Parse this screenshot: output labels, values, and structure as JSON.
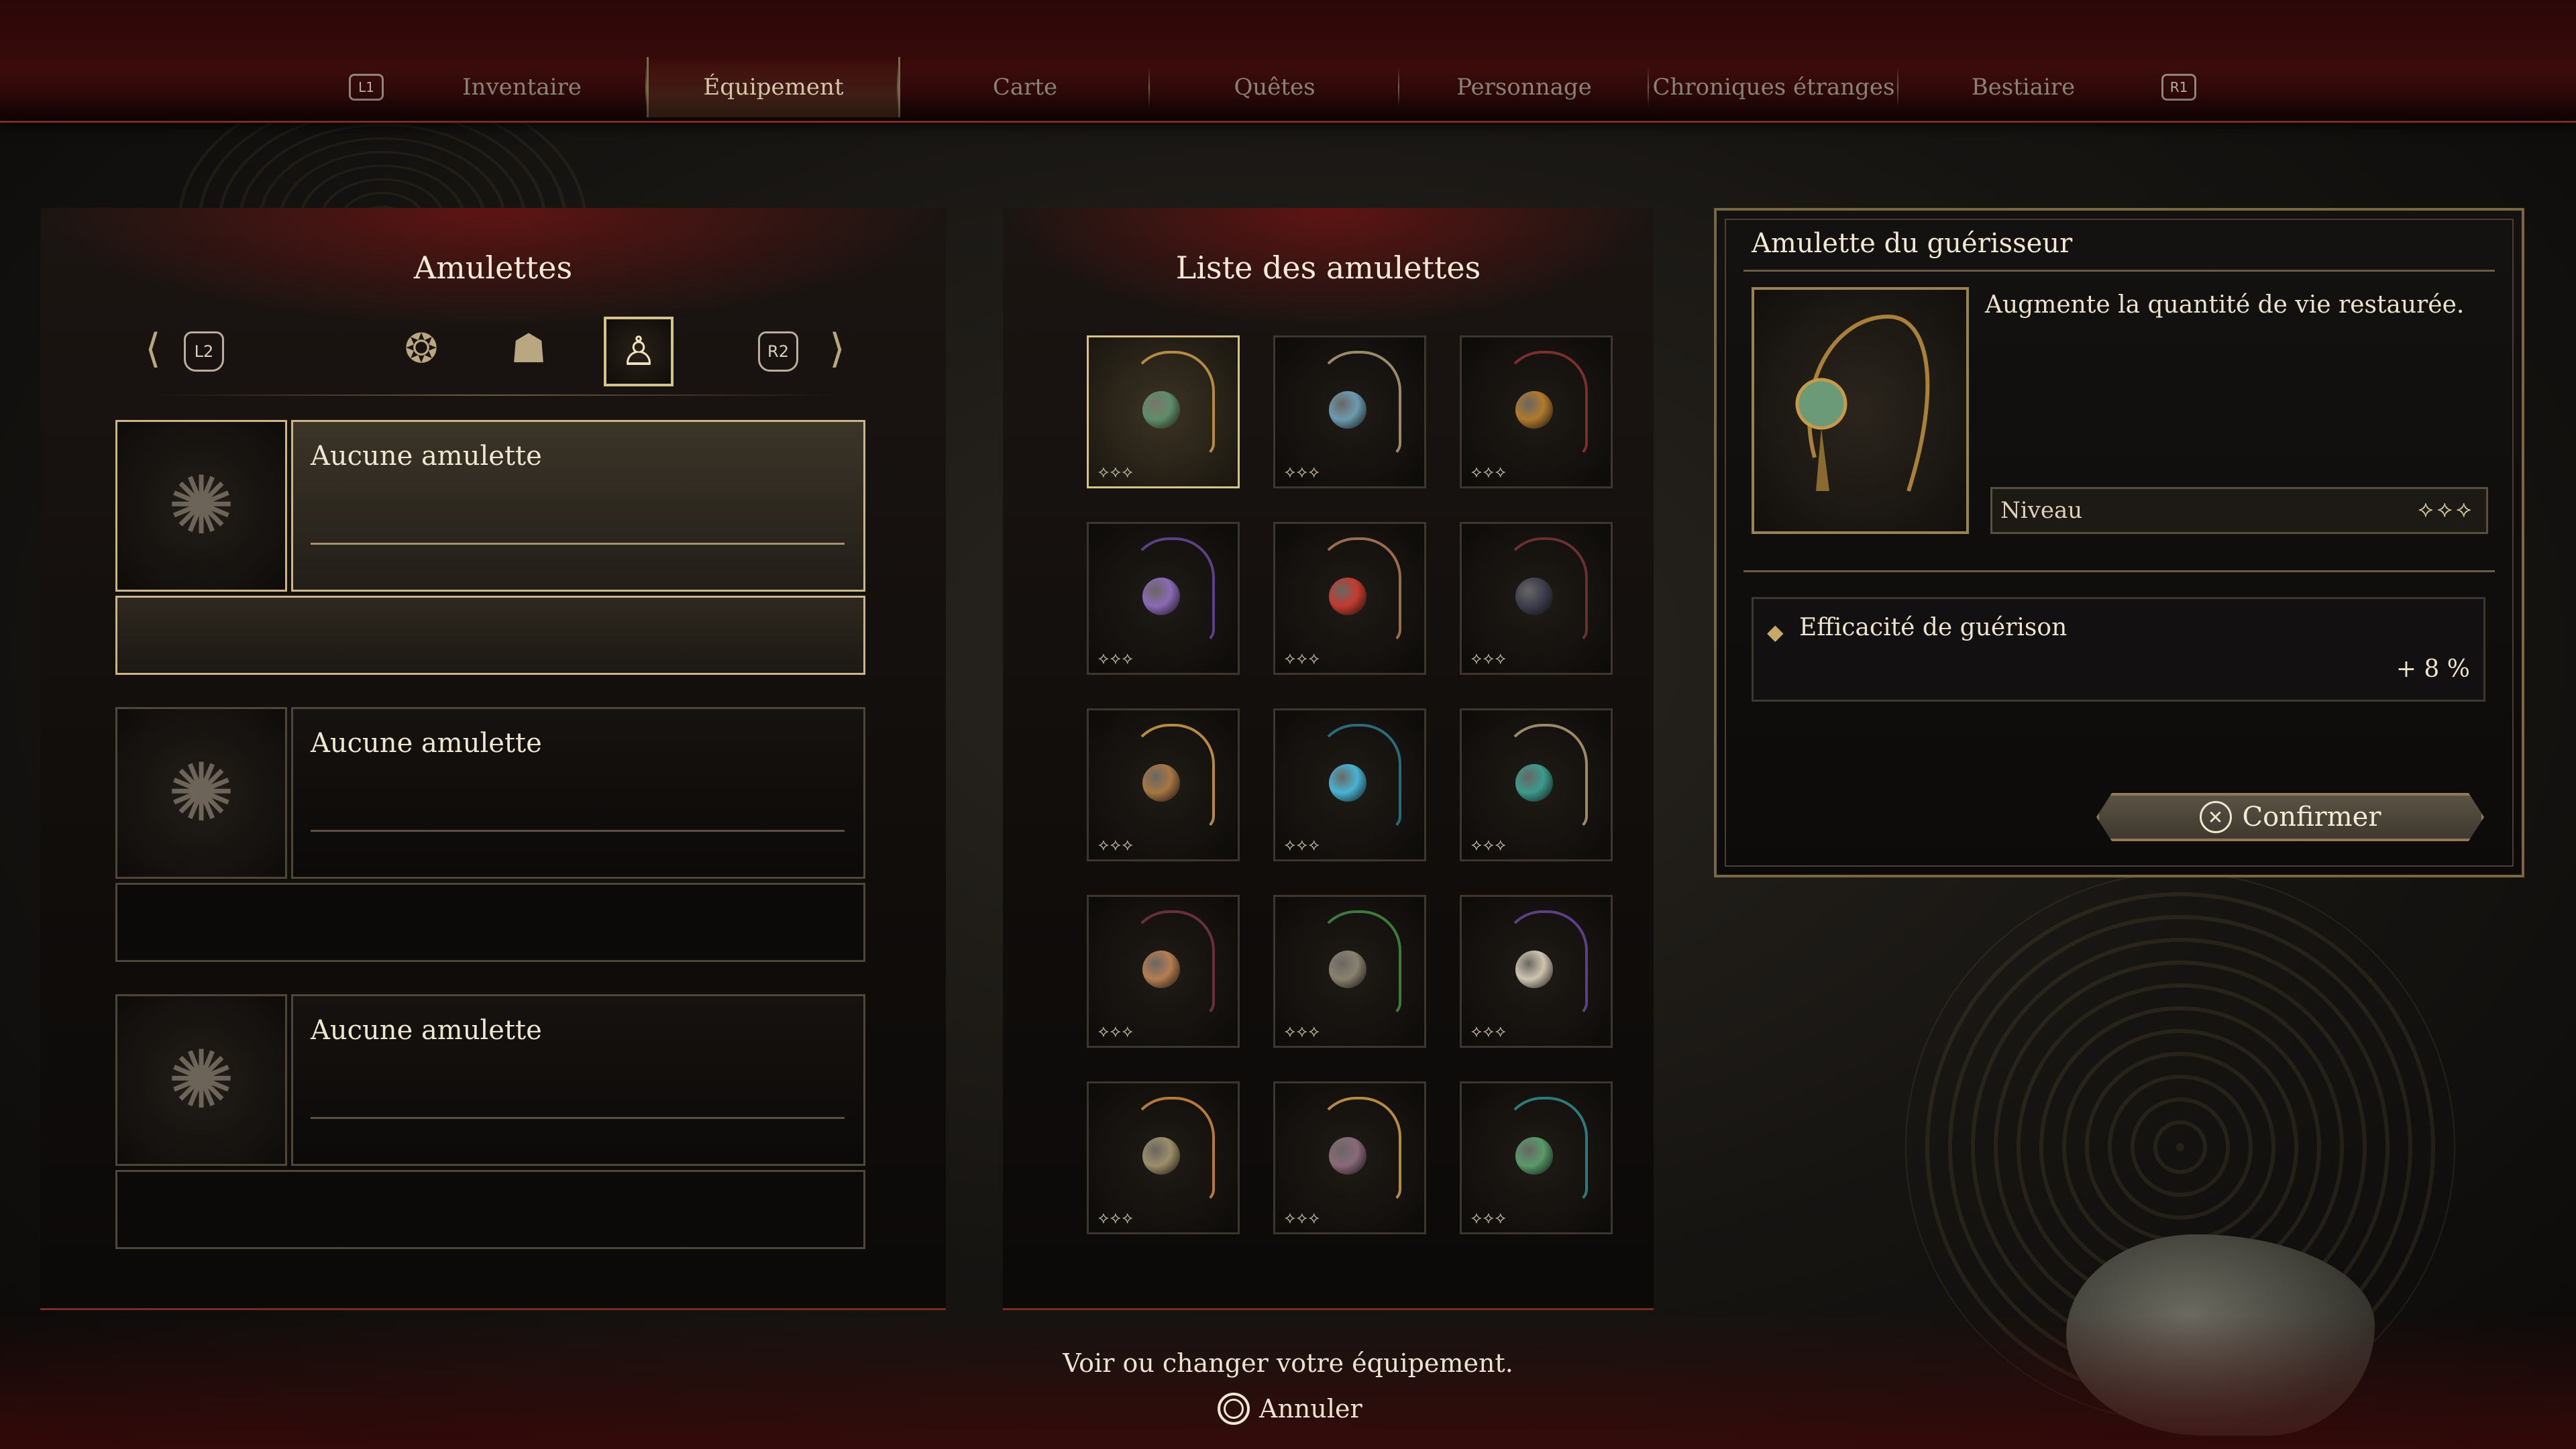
{
  "tabs": {
    "left_button": "L1",
    "right_button": "R1",
    "items": [
      "Inventaire",
      "Équipement",
      "Carte",
      "Quêtes",
      "Personnage",
      "Chroniques étranges",
      "Bestiaire"
    ],
    "active_index": 1
  },
  "left_panel": {
    "title": "Amulettes",
    "prev_button": "L2",
    "next_button": "R2",
    "categories": [
      "dragon-left-icon",
      "beads-icon",
      "oni-mask-icon",
      "guardian-icon",
      "dragon-right-icon"
    ],
    "selected_category": "guardian-icon",
    "slots": [
      {
        "name": "Aucune amulette",
        "active": true
      },
      {
        "name": "Aucune amulette",
        "active": false
      },
      {
        "name": "Aucune amulette",
        "active": false
      }
    ]
  },
  "middle_panel": {
    "title": "Liste des amulettes",
    "items": [
      {
        "gem_color": "#5e8d6a",
        "cord_color": "#b58a45",
        "level": "⟡⟡⟡",
        "selected": true
      },
      {
        "gem_color": "#6d9bb0",
        "cord_color": "#9a8a6a",
        "level": "⟡⟡⟡",
        "selected": false
      },
      {
        "gem_color": "#b07a2e",
        "cord_color": "#7a2f2a",
        "level": "⟡⟡⟡",
        "selected": false
      },
      {
        "gem_color": "#8a6ab5",
        "cord_color": "#5d3f86",
        "level": "⟡⟡⟡",
        "selected": false
      },
      {
        "gem_color": "#c23b30",
        "cord_color": "#9a6b4e",
        "level": "⟡⟡⟡",
        "selected": false
      },
      {
        "gem_color": "#3e3e4e",
        "cord_color": "#6a2f2f",
        "level": "⟡⟡⟡",
        "selected": false
      },
      {
        "gem_color": "#a77645",
        "cord_color": "#b58a45",
        "level": "⟡⟡⟡",
        "selected": false
      },
      {
        "gem_color": "#49b3d4",
        "cord_color": "#2c6a7a",
        "level": "⟡⟡⟡",
        "selected": false
      },
      {
        "gem_color": "#3e9a8d",
        "cord_color": "#9a8a6a",
        "level": "⟡⟡⟡",
        "selected": false
      },
      {
        "gem_color": "#b57d52",
        "cord_color": "#6a2f3c",
        "level": "⟡⟡⟡",
        "selected": false
      },
      {
        "gem_color": "#8a8270",
        "cord_color": "#3d7a3d",
        "level": "⟡⟡⟡",
        "selected": false
      },
      {
        "gem_color": "#cfc4b0",
        "cord_color": "#5d3f86",
        "level": "⟡⟡⟡",
        "selected": false
      },
      {
        "gem_color": "#9c8f6a",
        "cord_color": "#b57a3a",
        "level": "⟡⟡⟡",
        "selected": false
      },
      {
        "gem_color": "#8a6a7a",
        "cord_color": "#b58a45",
        "level": "⟡⟡⟡",
        "selected": false
      },
      {
        "gem_color": "#5a9a6a",
        "cord_color": "#2c7a7a",
        "level": "⟡⟡⟡",
        "selected": false
      }
    ]
  },
  "detail": {
    "title": "Amulette du guérisseur",
    "description": "Augmente la quantité de vie restaurée.",
    "level_label": "Niveau",
    "level_value": "⟡⟡⟡",
    "stat_name": "Efficacité de guérison",
    "stat_value": "+ 8 %",
    "confirm_label": "Confirmer",
    "confirm_button_icon": "cross-button-icon"
  },
  "footer": {
    "hint": "Voir ou changer votre équipement.",
    "cancel_label": "Annuler",
    "cancel_button_icon": "circle-button-icon"
  }
}
